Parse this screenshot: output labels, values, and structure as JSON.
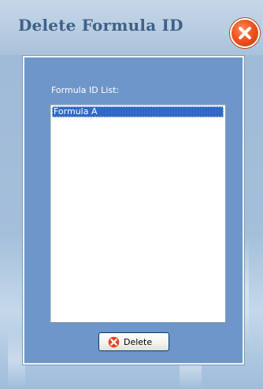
{
  "window": {
    "title": "Delete Formula ID"
  },
  "icons": {
    "close": "close-x-icon",
    "delete": "red-x-icon"
  },
  "colors": {
    "title_text": "#3f6189",
    "panel": "#6e96c9",
    "selection": "#316ac5",
    "close_button": "#f0541e"
  },
  "form": {
    "list_label": "Formula ID List:",
    "items": [
      "Formula A"
    ],
    "selected_index": 0,
    "delete_label": "Delete"
  }
}
